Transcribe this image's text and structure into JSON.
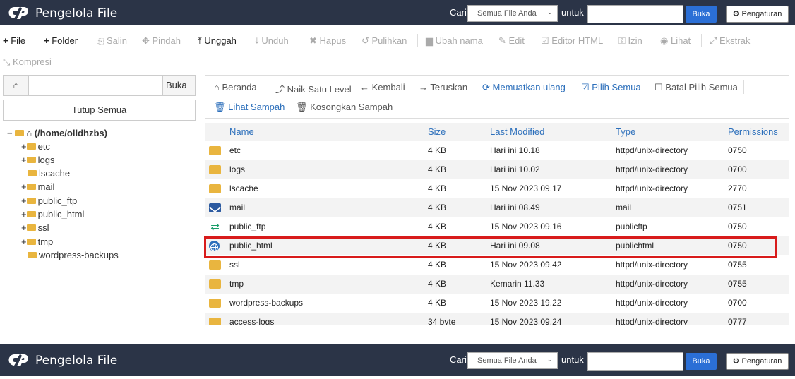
{
  "app": {
    "title": "Pengelola File",
    "search_label": "Cari",
    "search_scope": "Semua File Anda",
    "untuk_label": "untuk",
    "buka_button": "Buka",
    "settings_button": "Pengaturan"
  },
  "toolbar": {
    "file": "File",
    "folder": "Folder",
    "salin": "Salin",
    "pindah": "Pindah",
    "unggah": "Unggah",
    "unduh": "Unduh",
    "hapus": "Hapus",
    "pulihkan": "Pulihkan",
    "ubah_nama": "Ubah nama",
    "edit": "Edit",
    "editor_html": "Editor HTML",
    "izin": "Izin",
    "lihat": "Lihat",
    "ekstrak": "Ekstrak",
    "kompresi": "Kompresi"
  },
  "sidebar": {
    "buka": "Buka",
    "tutup_semua": "Tutup Semua",
    "root": "(/home/olldhzbs)",
    "items": [
      {
        "expander": "+",
        "label": "etc"
      },
      {
        "expander": "+",
        "label": "logs"
      },
      {
        "expander": "",
        "label": "lscache"
      },
      {
        "expander": "+",
        "label": "mail"
      },
      {
        "expander": "+",
        "label": "public_ftp"
      },
      {
        "expander": "+",
        "label": "public_html"
      },
      {
        "expander": "+",
        "label": "ssl"
      },
      {
        "expander": "+",
        "label": "tmp"
      },
      {
        "expander": "",
        "label": "wordpress-backups"
      }
    ]
  },
  "nav": {
    "beranda": "Beranda",
    "naik": "Naik Satu Level",
    "kembali": "Kembali",
    "teruskan": "Teruskan",
    "muat_ulang": "Memuatkan ulang",
    "pilih_semua": "Pilih Semua",
    "batal_pilih": "Batal Pilih Semua",
    "lihat_sampah": "Lihat Sampah",
    "kosongkan": "Kosongkan Sampah"
  },
  "table": {
    "headers": {
      "name": "Name",
      "size": "Size",
      "modified": "Last Modified",
      "type": "Type",
      "perm": "Permissions"
    },
    "rows": [
      {
        "icon": "folder",
        "name": "etc",
        "size": "4 KB",
        "modified": "Hari ini 10.18",
        "type": "httpd/unix-directory",
        "perm": "0750"
      },
      {
        "icon": "folder",
        "name": "logs",
        "size": "4 KB",
        "modified": "Hari ini 10.02",
        "type": "httpd/unix-directory",
        "perm": "0700"
      },
      {
        "icon": "folder",
        "name": "lscache",
        "size": "4 KB",
        "modified": "15 Nov 2023 09.17",
        "type": "httpd/unix-directory",
        "perm": "2770"
      },
      {
        "icon": "mail",
        "name": "mail",
        "size": "4 KB",
        "modified": "Hari ini 08.49",
        "type": "mail",
        "perm": "0751"
      },
      {
        "icon": "ftp",
        "name": "public_ftp",
        "size": "4 KB",
        "modified": "15 Nov 2023 09.16",
        "type": "publicftp",
        "perm": "0750"
      },
      {
        "icon": "globe",
        "name": "public_html",
        "size": "4 KB",
        "modified": "Hari ini 09.08",
        "type": "publichtml",
        "perm": "0750"
      },
      {
        "icon": "folder",
        "name": "ssl",
        "size": "4 KB",
        "modified": "15 Nov 2023 09.42",
        "type": "httpd/unix-directory",
        "perm": "0755"
      },
      {
        "icon": "folder",
        "name": "tmp",
        "size": "4 KB",
        "modified": "Kemarin 11.33",
        "type": "httpd/unix-directory",
        "perm": "0755"
      },
      {
        "icon": "folder",
        "name": "wordpress-backups",
        "size": "4 KB",
        "modified": "15 Nov 2023 19.22",
        "type": "httpd/unix-directory",
        "perm": "0700"
      },
      {
        "icon": "folder",
        "name": "access-logs",
        "size": "34 byte",
        "modified": "15 Nov 2023 09.24",
        "type": "httpd/unix-directory",
        "perm": "0777"
      }
    ]
  },
  "colors": {
    "header_bg": "#2b3447",
    "accent": "#2c6fbb",
    "buka_bg": "#2b6fd6",
    "highlight": "#d81b1b",
    "folder": "#e9b53f"
  }
}
